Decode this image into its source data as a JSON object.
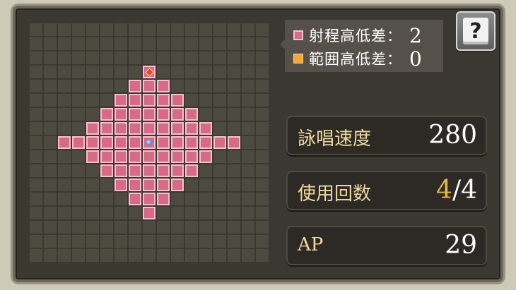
{
  "legend": {
    "range_height_label": "射程高低差：",
    "range_height_value": "2",
    "area_height_label": "範囲高低差：",
    "area_height_value": "0",
    "range_color": "#d76a85",
    "area_color": "#f2a93a"
  },
  "help_button": {
    "glyph": "?"
  },
  "stats": {
    "cast_speed": {
      "label": "詠唱速度",
      "value": "280"
    },
    "uses": {
      "label": "使用回数",
      "current": "4",
      "separator": "/",
      "max": "4"
    },
    "ap": {
      "label": "AP",
      "value": "29"
    }
  },
  "grid": {
    "size": 17,
    "caster_cell": [
      8,
      8
    ],
    "target_marker_cell": [
      8,
      3
    ],
    "range_rows": [
      [],
      [],
      [],
      [],
      [
        7,
        8,
        9
      ],
      [
        6,
        7,
        8,
        9,
        10
      ],
      [
        5,
        6,
        7,
        8,
        9,
        10,
        11
      ],
      [
        4,
        5,
        6,
        7,
        8,
        9,
        10,
        11,
        12
      ],
      [
        3,
        4,
        5,
        6,
        7,
        8,
        9,
        10,
        11,
        12,
        13
      ],
      [
        4,
        5,
        6,
        7,
        8,
        9,
        10,
        11,
        12
      ],
      [
        5,
        6,
        7,
        8,
        9,
        10,
        11
      ],
      [
        6,
        7,
        8,
        9,
        10
      ],
      [
        7,
        8,
        9
      ],
      [
        8
      ],
      [],
      [],
      []
    ],
    "extra_range_cells": [
      [
        8,
        3
      ],
      [
        2,
        8
      ],
      [
        14,
        8
      ]
    ]
  }
}
